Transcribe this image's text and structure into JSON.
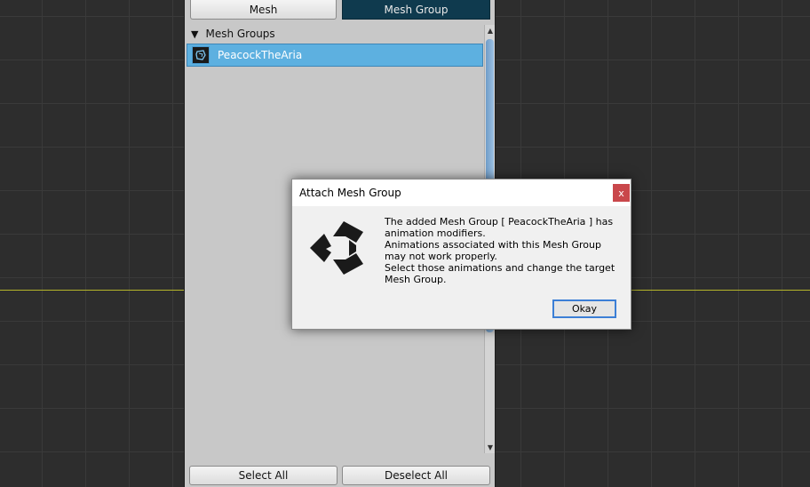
{
  "panel": {
    "tabs": {
      "mesh": "Mesh",
      "mesh_group": "Mesh Group"
    },
    "list_header": "Mesh Groups",
    "items": [
      {
        "label": "PeacockTheAria"
      }
    ],
    "buttons": {
      "select_all": "Select All",
      "deselect_all": "Deselect All"
    }
  },
  "dialog": {
    "title": "Attach Mesh Group",
    "close_label": "x",
    "lines": [
      "The added Mesh Group [ PeacockTheAria ] has animation modifiers.",
      "Animations associated with this Mesh Group may not work properly.",
      "Select those animations and change the target Mesh Group."
    ],
    "ok_label": "Okay"
  },
  "colors": {
    "selected_item": "#5db0e0",
    "active_tab": "#0f3a4e",
    "close_button": "#c9474b",
    "horizon_line": "#b5b52a"
  },
  "icons": {
    "list_item": "mesh-group-icon",
    "dialog_logo": "unity-logo-icon"
  }
}
